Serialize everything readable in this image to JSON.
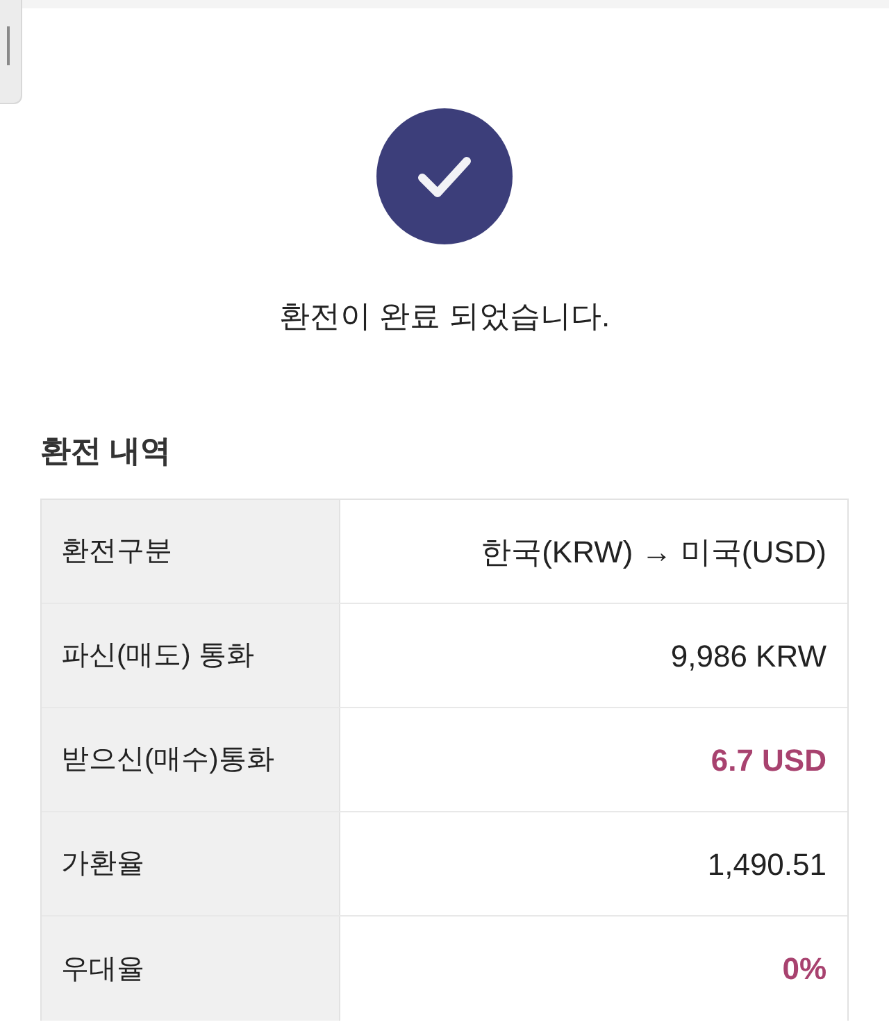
{
  "status": {
    "message": "환전이 완료 되었습니다."
  },
  "details": {
    "title": "환전 내역",
    "rows": [
      {
        "label": "환전구분",
        "value": "한국(KRW) → 미국(USD)",
        "emphasis": false
      },
      {
        "label": "파신(매도) 통화",
        "value": "9,986 KRW",
        "emphasis": false
      },
      {
        "label": "받으신(매수)통화",
        "value": "6.7 USD",
        "emphasis": true
      },
      {
        "label": "가환율",
        "value": "1,490.51",
        "emphasis": false
      },
      {
        "label": "우대율",
        "value": "0%",
        "emphasis": true
      }
    ]
  }
}
